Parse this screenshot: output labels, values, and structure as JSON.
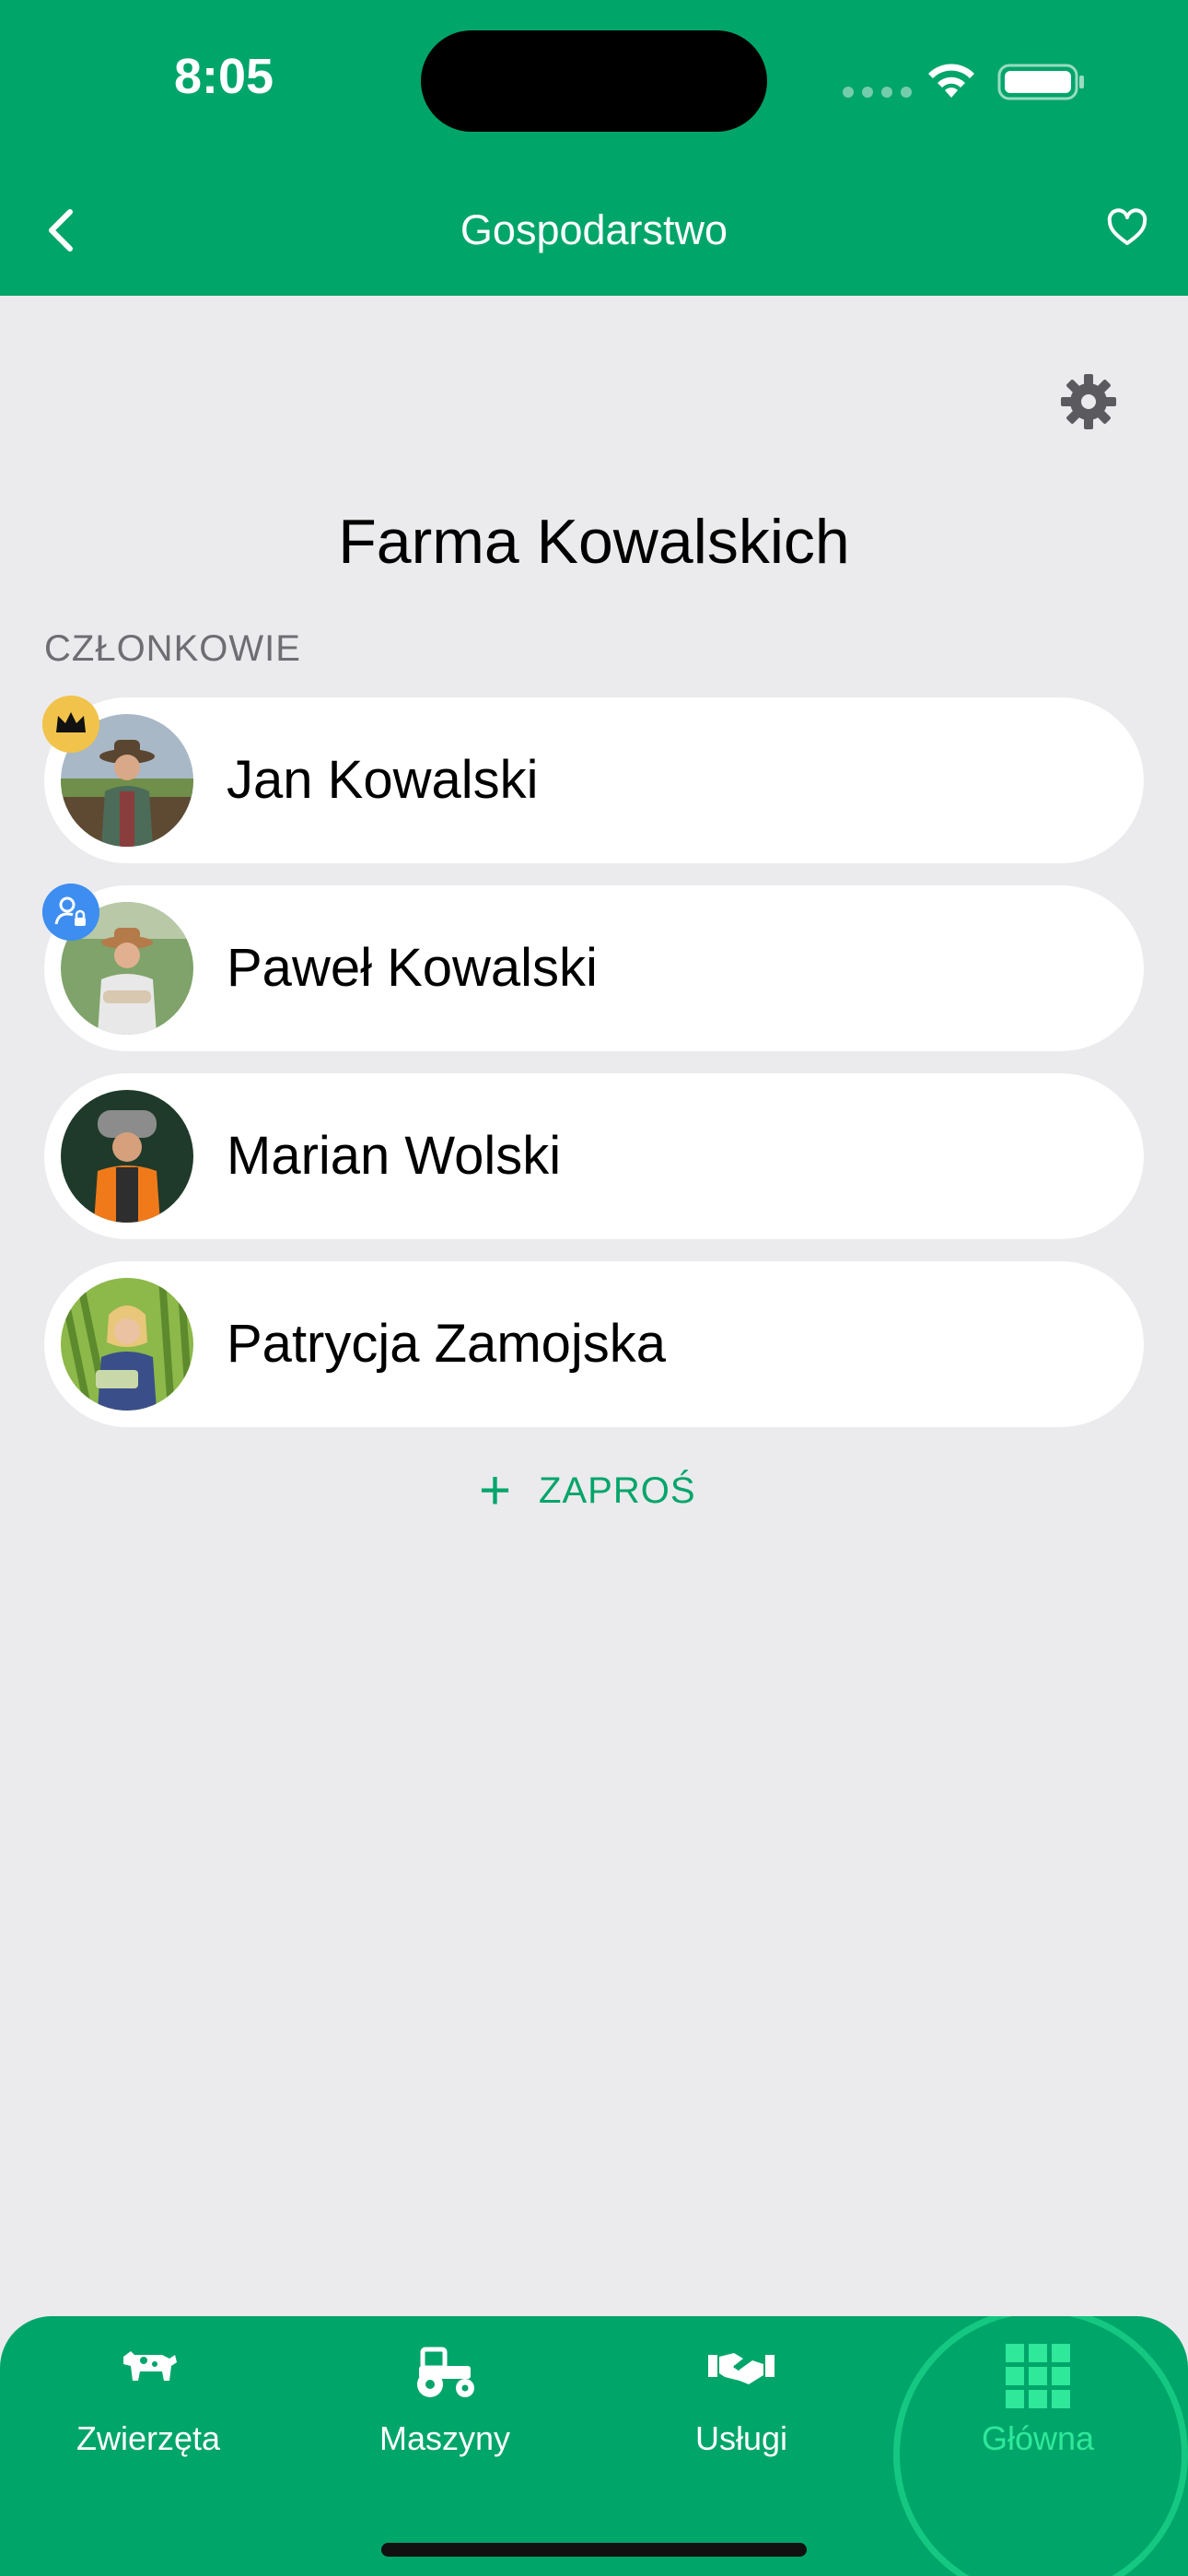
{
  "status_bar": {
    "time": "8:05"
  },
  "nav": {
    "title": "Gospodarstwo",
    "back_icon": "chevron-left-icon",
    "favorite_icon": "heart-icon"
  },
  "farm": {
    "name": "Farma Kowalskich",
    "settings_icon": "gear-icon"
  },
  "members_section": {
    "label": "CZŁONKOWIE",
    "members": [
      {
        "name": "Jan Kowalski",
        "badge": "crown-icon"
      },
      {
        "name": "Paweł Kowalski",
        "badge": "admin-user-icon"
      },
      {
        "name": "Marian Wolski",
        "badge": ""
      },
      {
        "name": "Patrycja Zamojska",
        "badge": ""
      }
    ],
    "invite_label": "ZAPROŚ"
  },
  "tabbar": {
    "tabs": [
      {
        "label": "Zwierzęta",
        "icon": "cow-icon"
      },
      {
        "label": "Maszyny",
        "icon": "tractor-icon"
      },
      {
        "label": "Usługi",
        "icon": "handshake-icon"
      },
      {
        "label": "Główna",
        "icon": "grid-icon",
        "active": true
      }
    ]
  },
  "colors": {
    "primary": "#00A56A",
    "active_tab": "#2FE89A",
    "background": "#EBEAED"
  }
}
